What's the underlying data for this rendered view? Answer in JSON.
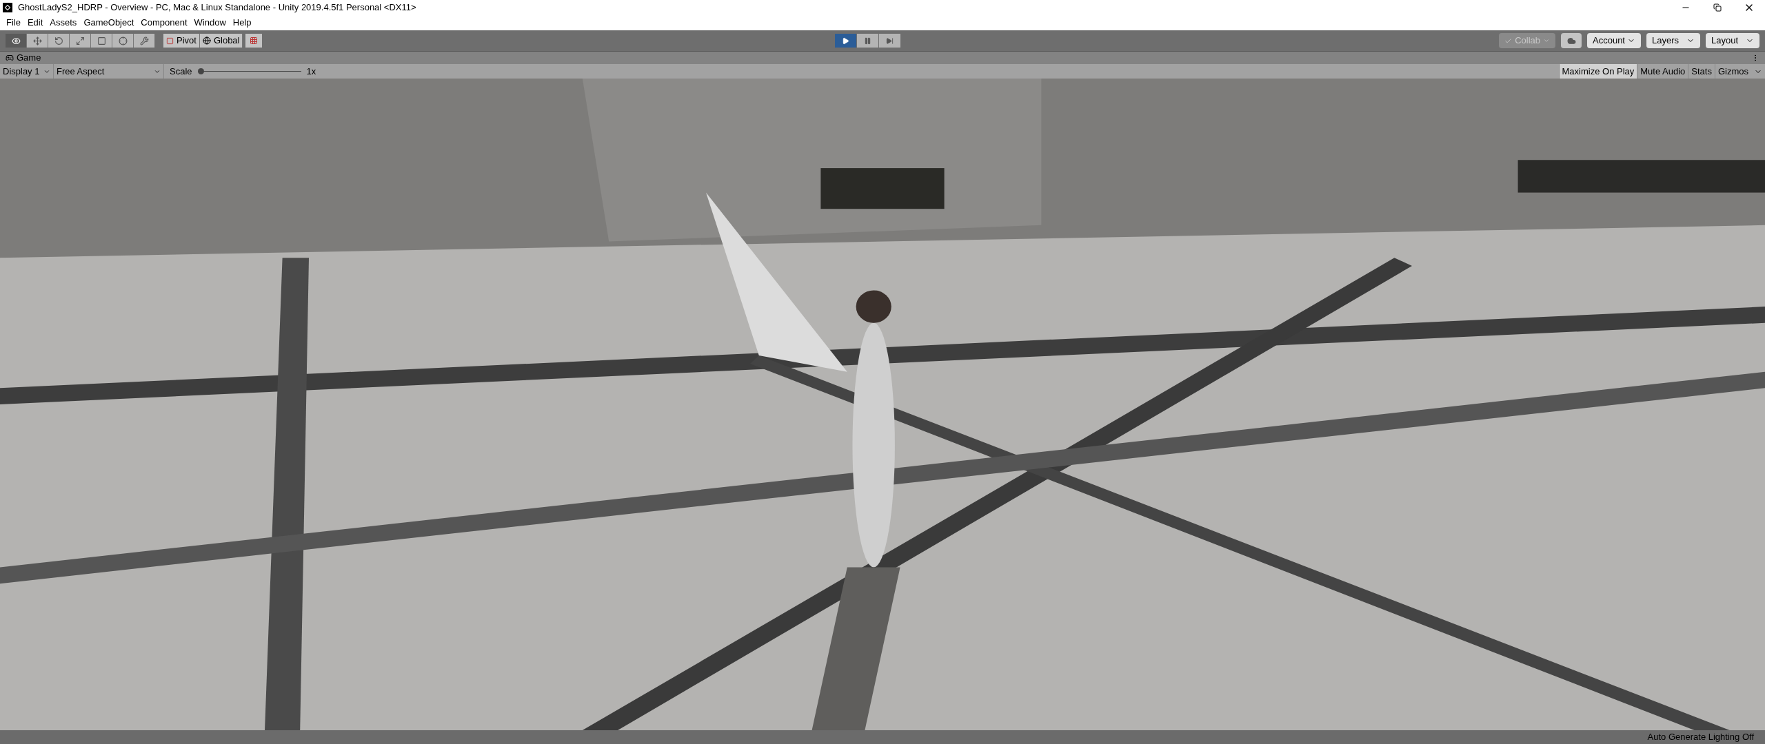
{
  "window": {
    "title": "GhostLadyS2_HDRP - Overview - PC, Mac & Linux Standalone - Unity 2019.4.5f1 Personal <DX11>"
  },
  "menu": [
    "File",
    "Edit",
    "Assets",
    "GameObject",
    "Component",
    "Window",
    "Help"
  ],
  "tools": [
    {
      "kind": "view",
      "selected": true
    },
    {
      "kind": "move",
      "selected": false
    },
    {
      "kind": "rotate",
      "selected": false
    },
    {
      "kind": "scale",
      "selected": false
    },
    {
      "kind": "rect",
      "selected": false
    },
    {
      "kind": "transform",
      "selected": false
    },
    {
      "kind": "custom",
      "selected": false
    }
  ],
  "pivot_buttons": [
    {
      "label": "Pivot",
      "kind": "pivot"
    },
    {
      "label": "Global",
      "kind": "global"
    }
  ],
  "playback": [
    {
      "kind": "play",
      "on": true
    },
    {
      "kind": "pause",
      "on": false
    },
    {
      "kind": "step",
      "on": false
    }
  ],
  "right_toolbar": {
    "collab": "Collab",
    "account": "Account",
    "layers": "Layers",
    "layout": "Layout"
  },
  "game_tab": {
    "label": "Game"
  },
  "game_toolbar": {
    "display": "Display 1",
    "aspect": "Free Aspect",
    "scale_label": "Scale",
    "scale": {
      "level": 0
    },
    "scale_value": "1x",
    "toggles": [
      {
        "label": "Maximize On Play",
        "on": true
      },
      {
        "label": "Mute Audio",
        "on": false
      },
      {
        "label": "Stats",
        "on": false
      },
      {
        "label": "Gizmos",
        "on": false
      }
    ]
  },
  "status_bar": {
    "text": "Auto Generate Lighting Off"
  }
}
